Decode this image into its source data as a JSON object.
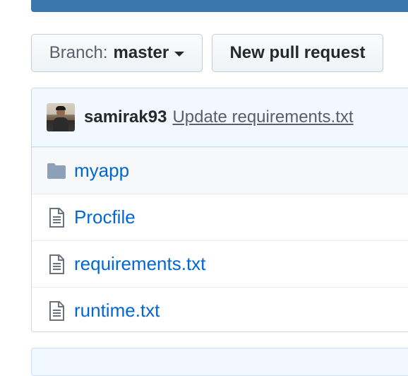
{
  "toolbar": {
    "branch_label": "Branch:",
    "branch_name": "master",
    "new_pr_label": "New pull request"
  },
  "commit": {
    "author": "samirak93",
    "message": "Update requirements.txt"
  },
  "files": [
    {
      "name": "myapp",
      "type": "directory",
      "icon": "folder-icon"
    },
    {
      "name": "Procfile",
      "type": "file",
      "icon": "file-icon"
    },
    {
      "name": "requirements.txt",
      "type": "file",
      "icon": "file-icon"
    },
    {
      "name": "runtime.txt",
      "type": "file",
      "icon": "file-icon"
    }
  ],
  "colors": {
    "link": "#0366d6",
    "header_bar": "#3b77ad",
    "commit_bg": "#f1f8ff",
    "folder_icon": "#79b8ff"
  }
}
